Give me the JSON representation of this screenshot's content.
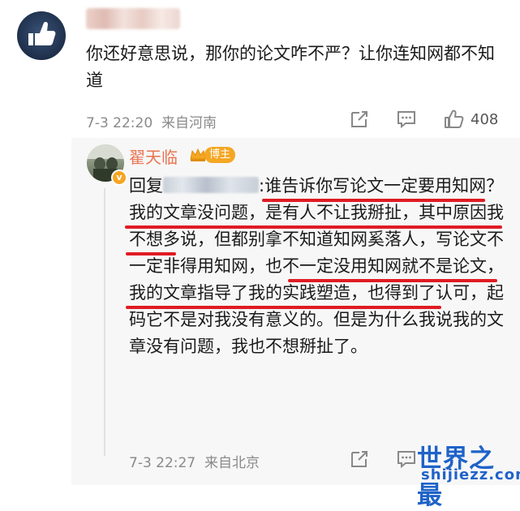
{
  "comment": {
    "text": "你还好意思说，那你的论文咋不严？让你连知网都不知道",
    "time": "7-3 22:20",
    "location": "来自河南",
    "like_count": "408"
  },
  "reply": {
    "username": "翟天临",
    "badge": "博主",
    "prefix": "回复",
    "text": ":谁告诉你写论文一定要用知网？我的文章没问题，是有人不让我掰扯，其中原因我不想多说，但都别拿不知道知网奚落人，写论文不一定非得用知网，也不一定没用知网就不是论文，我的文章指导了我的实践塑造，也得到了认可，起码它不是对我没有意义的。但是为什么我说我的文章没有问题，我也不想掰扯了。",
    "time": "7-3 22:27",
    "location": "来自北京"
  },
  "watermark": {
    "title": "世界之最",
    "url": "shijiezz.com"
  },
  "colors": {
    "username": "#eb7350",
    "badge": "#f5a623",
    "underline": "#e01b24",
    "watermark": "#1f63c8",
    "meta": "#8a8a8a"
  },
  "icons": [
    "thumbs-up-icon",
    "share-icon",
    "comment-icon",
    "like-icon",
    "verified-icon",
    "crown-icon"
  ]
}
